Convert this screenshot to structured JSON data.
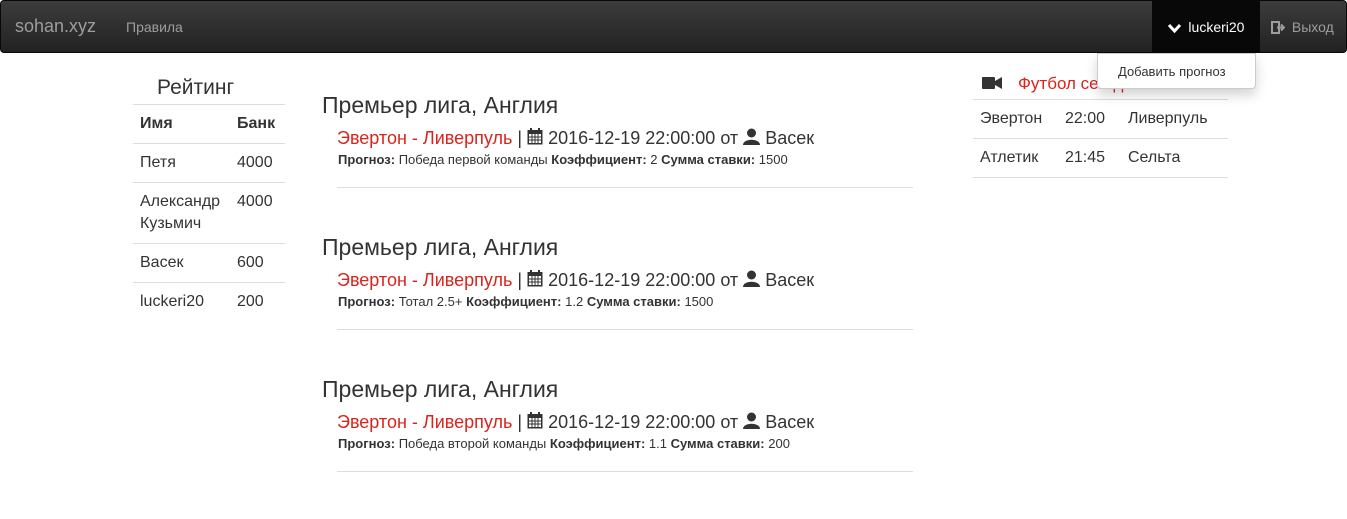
{
  "navbar": {
    "brand": "sohan.xyz",
    "rules_link": "Правила",
    "user": "luckeri20",
    "logout": "Выход",
    "dropdown_item": "Добавить прогноз"
  },
  "rating": {
    "title": "Рейтинг",
    "headers": [
      "Имя",
      "Банк"
    ],
    "rows": [
      {
        "name": "Петя",
        "bank": "4000"
      },
      {
        "name": "Александр Кузьмич",
        "bank": "4000"
      },
      {
        "name": "Васек",
        "bank": "600"
      },
      {
        "name": "luckeri20",
        "bank": "200"
      }
    ]
  },
  "forecasts": [
    {
      "league": "Премьер лига, Англия",
      "match": "Эвертон - Ливерпуль",
      "datetime": "2016-12-19 22:00:00",
      "from_label": "от",
      "author": "Васек",
      "forecast_label": "Прогноз:",
      "forecast": "Победа первой команды",
      "coef_label": "Коэффициент:",
      "coef": "2",
      "stake_label": "Сумма ставки:",
      "stake": "1500"
    },
    {
      "league": "Премьер лига, Англия",
      "match": "Эвертон - Ливерпуль",
      "datetime": "2016-12-19 22:00:00",
      "from_label": "от",
      "author": "Васек",
      "forecast_label": "Прогноз:",
      "forecast": "Тотал 2.5+",
      "coef_label": "Коэффициент:",
      "coef": "1.2",
      "stake_label": "Сумма ставки:",
      "stake": "1500"
    },
    {
      "league": "Премьер лига, Англия",
      "match": "Эвертон - Ливерпуль",
      "datetime": "2016-12-19 22:00:00",
      "from_label": "от",
      "author": "Васек",
      "forecast_label": "Прогноз:",
      "forecast": "Победа второй команды",
      "coef_label": "Коэффициент:",
      "coef": "1.1",
      "stake_label": "Сумма ставки:",
      "stake": "200"
    }
  ],
  "today": {
    "title": "Футбол сегодня",
    "games": [
      {
        "home": "Эвертон",
        "time": "22:00",
        "away": "Ливерпуль"
      },
      {
        "home": "Атлетик",
        "time": "21:45",
        "away": "Сельта"
      }
    ]
  },
  "colors": {
    "accent_red": "#d9241c",
    "navbar_bg": "#222222"
  },
  "icons": [
    "chevron-down-icon",
    "logout-icon",
    "calendar-icon",
    "user-icon",
    "video-camera-icon"
  ]
}
